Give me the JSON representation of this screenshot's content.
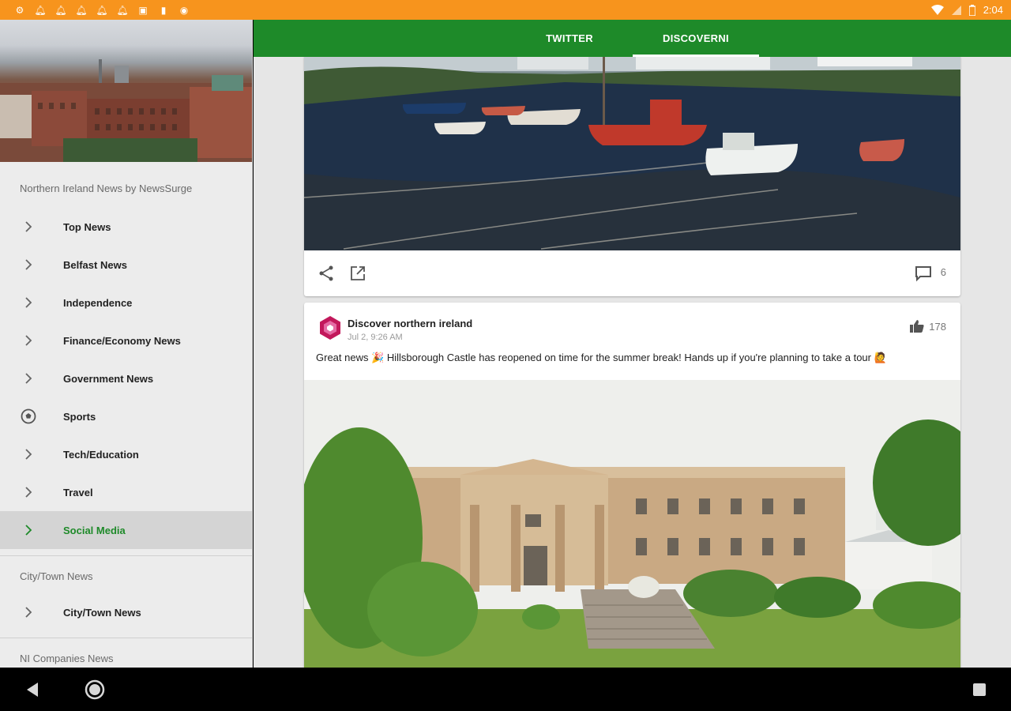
{
  "status_bar": {
    "time": "2:04",
    "left_icons": [
      "gear-icon",
      "bell-icon",
      "bell-icon",
      "bell-icon",
      "bell-icon",
      "bell-icon",
      "image-icon",
      "sd-card-icon",
      "app-icon"
    ],
    "background_color": "#f7941d"
  },
  "drawer": {
    "app_title": "Northern Ireland News by NewsSurge",
    "items": [
      {
        "label": "Top News",
        "icon": "chevron-right-icon",
        "active": false
      },
      {
        "label": "Belfast News",
        "icon": "chevron-right-icon",
        "active": false
      },
      {
        "label": "Independence",
        "icon": "chevron-right-icon",
        "active": false
      },
      {
        "label": "Finance/Economy News",
        "icon": "chevron-right-icon",
        "active": false
      },
      {
        "label": "Government News",
        "icon": "chevron-right-icon",
        "active": false
      },
      {
        "label": "Sports",
        "icon": "soccer-ball-icon",
        "active": false
      },
      {
        "label": "Tech/Education",
        "icon": "chevron-right-icon",
        "active": false
      },
      {
        "label": "Travel",
        "icon": "chevron-right-icon",
        "active": false
      },
      {
        "label": "Social Media",
        "icon": "chevron-right-icon",
        "active": true
      }
    ],
    "section2_title": "City/Town News",
    "section2_items": [
      {
        "label": "City/Town News",
        "icon": "chevron-right-icon"
      }
    ],
    "section3_title": "NI Companies News"
  },
  "tabs": [
    {
      "label": "TWITTER",
      "active": false
    },
    {
      "label": "DISCOVERNI",
      "active": true
    }
  ],
  "feed": {
    "card1": {
      "comment_count": "6"
    },
    "card2": {
      "author": "Discover northern ireland",
      "date": "Jul 2, 9:26 AM",
      "likes": "178",
      "text": "Great news 🎉 Hillsborough Castle has reopened on time for the summer break! Hands up if you're planning to take a tour 🙋"
    }
  },
  "colors": {
    "accent_green": "#1e8a29",
    "status_orange": "#f7941d"
  }
}
